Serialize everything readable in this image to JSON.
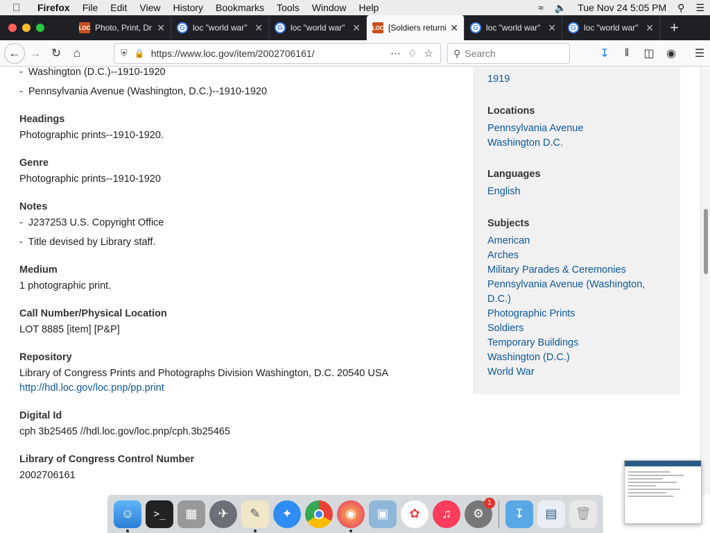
{
  "menubar": {
    "apple": "",
    "items": [
      "Firefox",
      "File",
      "Edit",
      "View",
      "History",
      "Bookmarks",
      "Tools",
      "Window",
      "Help"
    ],
    "clock": "Tue Nov 24  5:05 PM"
  },
  "tabs": [
    {
      "favicon": "LOC",
      "title": "Photo, Print, Dr",
      "active": false
    },
    {
      "favicon": "G",
      "title": "loc \"world war\"",
      "active": false
    },
    {
      "favicon": "G",
      "title": "loc \"world war\"",
      "active": false
    },
    {
      "favicon": "LOC",
      "title": "[Soldiers returni",
      "active": true
    },
    {
      "favicon": "G",
      "title": "loc \"world war\"",
      "active": false
    },
    {
      "favicon": "G",
      "title": "loc \"world war\"",
      "active": false
    }
  ],
  "navbar": {
    "url": "https://www.loc.gov/item/2002706161/",
    "search_placeholder": "Search"
  },
  "details": {
    "subject_bullets": [
      "Washington (D.C.)--1910-1920",
      "Pennsylvania Avenue (Washington, D.C.)--1910-1920"
    ],
    "headings": {
      "label": "Headings",
      "value": "Photographic prints--1910-1920."
    },
    "genre": {
      "label": "Genre",
      "value": "Photographic prints--1910-1920"
    },
    "notes": {
      "label": "Notes",
      "items": [
        "J237253 U.S. Copyright Office",
        "Title devised by Library staff."
      ]
    },
    "medium": {
      "label": "Medium",
      "value": "1 photographic print."
    },
    "call_number": {
      "label": "Call Number/Physical Location",
      "value": "LOT 8885 [item] [P&P]"
    },
    "repository": {
      "label": "Repository",
      "value": "Library of Congress Prints and Photographs Division Washington, D.C. 20540 USA",
      "link": "http://hdl.loc.gov/loc.pnp/pp.print"
    },
    "digital_id": {
      "label": "Digital Id",
      "value": "cph 3b25465 //hdl.loc.gov/loc.pnp/cph.3b25465"
    },
    "lccn": {
      "label": "Library of Congress Control Number",
      "value": "2002706161"
    }
  },
  "sidebar": {
    "date_value": "1919",
    "locations": {
      "label": "Locations",
      "items": [
        "Pennsylvania Avenue",
        "Washington D.C."
      ]
    },
    "languages": {
      "label": "Languages",
      "items": [
        "English"
      ]
    },
    "subjects": {
      "label": "Subjects",
      "items": [
        "American",
        "Arches",
        "Military Parades & Ceremonies",
        "Pennsylvania Avenue (Washington, D.C.)",
        "Photographic Prints",
        "Soldiers",
        "Temporary Buildings",
        "Washington (D.C.)",
        "World War"
      ]
    }
  },
  "dock": {
    "apps": [
      "finder",
      "terminal",
      "calculator",
      "launchpad",
      "textedit",
      "safari",
      "chrome",
      "firefox",
      "preview",
      "photos",
      "music",
      "system-preferences",
      "downloads",
      "screenshot",
      "trash"
    ],
    "system_preferences_badge": "1"
  },
  "colors": {
    "link": "#0b5899",
    "sidebar_bg": "#f1f1f1",
    "tabstrip_bg": "#1f1f26"
  }
}
